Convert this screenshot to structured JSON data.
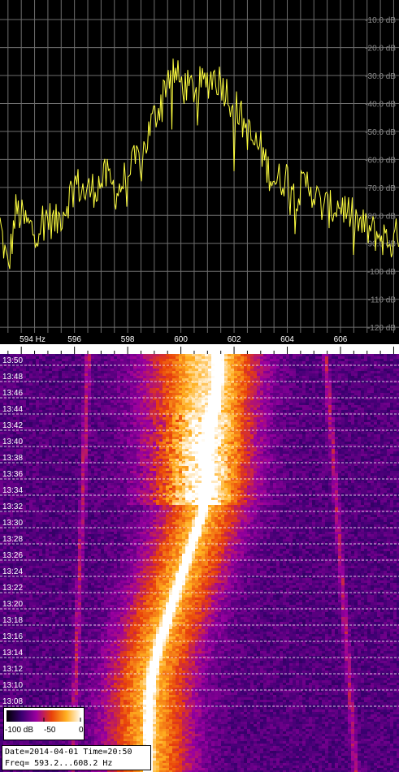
{
  "chart_data": [
    {
      "type": "line",
      "title": "",
      "xlabel": "",
      "ylabel": "",
      "xlim": [
        593.2,
        608.2
      ],
      "ylim": [
        -122,
        -3
      ],
      "x_ticks": [
        "594 Hz",
        "596",
        "598",
        "600",
        "602",
        "604",
        "606"
      ],
      "y_ticks": [
        "-10.0 dB",
        "-20.0 dB",
        "-30.0 dB",
        "-40.0 dB",
        "-50.0 dB",
        "-60.0 dB",
        "-70.0 dB",
        "-80.0 dB",
        "-90.0 dB",
        "-100 dB",
        "-110 dB",
        "-120 dB"
      ],
      "grid": true,
      "series": [
        {
          "color": "#ffff40",
          "x": [
            593.2,
            593.5,
            593.8,
            594.1,
            594.5,
            594.9,
            595.3,
            595.7,
            596.0,
            596.4,
            596.8,
            597.2,
            597.6,
            598.0,
            598.3,
            598.6,
            598.9,
            599.1,
            599.3,
            599.5,
            599.7,
            600.0,
            600.3,
            600.6,
            600.9,
            601.2,
            601.5,
            601.8,
            602.1,
            602.4,
            602.7,
            603.0,
            603.3,
            603.6,
            604.0,
            604.4,
            604.8,
            605.2,
            605.6,
            606.0,
            606.4,
            606.8,
            607.2,
            607.6,
            608.0,
            608.2
          ],
          "values": [
            -83,
            -100,
            -78,
            -82,
            -86,
            -80,
            -83,
            -76,
            -68,
            -72,
            -70,
            -66,
            -72,
            -65,
            -61,
            -57,
            -47,
            -43,
            -37,
            -30,
            -28,
            -33,
            -35,
            -34,
            -33,
            -30,
            -32,
            -37,
            -42,
            -48,
            -54,
            -56,
            -64,
            -68,
            -66,
            -72,
            -68,
            -76,
            -78,
            -76,
            -80,
            -84,
            -86,
            -88,
            -90,
            -85
          ]
        }
      ]
    },
    {
      "type": "heatmap",
      "title": "",
      "xlim": [
        593.2,
        608.2
      ],
      "y_ticks": [
        "13:50",
        "13:48",
        "13:46",
        "13:44",
        "13:42",
        "13:40",
        "13:38",
        "13:36",
        "13:34",
        "13:32",
        "13:30",
        "13:28",
        "13:26",
        "13:24",
        "13:22",
        "13:20",
        "13:18",
        "13:16",
        "13:14",
        "13:12",
        "13:10",
        "13:08"
      ],
      "colorscale": {
        "stops": [
          "#000000",
          "#3a0070",
          "#9a00a0",
          "#e8400a",
          "#ffb020",
          "#ffffff"
        ],
        "min_label": "-100 dB",
        "mid_label": "-50",
        "max_label": "0",
        "min": -100,
        "max": 0
      },
      "main_trace": {
        "times": [
          "13:08",
          "13:12",
          "13:16",
          "13:20",
          "13:24",
          "13:28",
          "13:32",
          "13:36",
          "13:40",
          "13:44",
          "13:48",
          "13:50"
        ],
        "freq": [
          598.8,
          598.9,
          599.2,
          599.6,
          600.0,
          600.4,
          600.8,
          601.0,
          601.0,
          601.2,
          601.4,
          601.4
        ]
      },
      "info": {
        "date_time": "Date=2014-04-01 Time=20:50",
        "freq": "Freq= 593.2...608.2 Hz"
      }
    }
  ]
}
